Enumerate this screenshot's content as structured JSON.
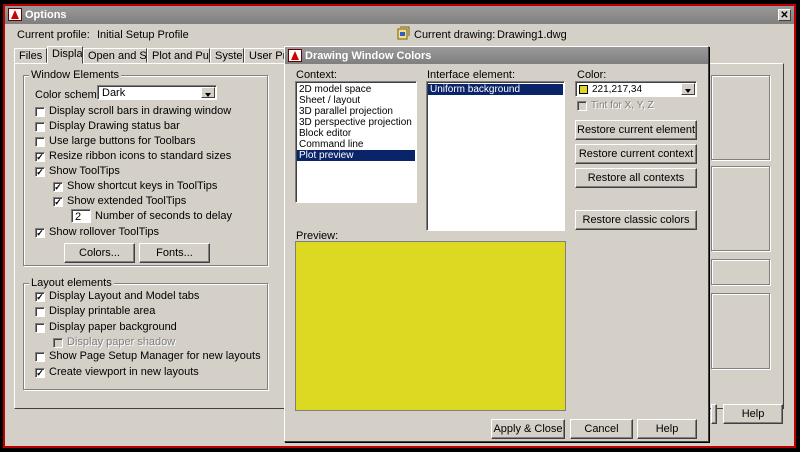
{
  "options_window": {
    "title": "Options",
    "current_profile_label": "Current profile:",
    "current_profile_value": "Initial Setup Profile",
    "current_drawing_label": "Current drawing:",
    "current_drawing_value": "Drawing1.dwg",
    "close_glyph": "✕",
    "tabs": [
      "Files",
      "Display",
      "Open and Save",
      "Plot and Publish",
      "System",
      "User Prefer"
    ],
    "active_tab": "Display",
    "window_elements": {
      "title": "Window Elements",
      "color_scheme_label": "Color scheme:",
      "color_scheme_value": "Dark",
      "items": [
        {
          "label": "Display scroll bars in drawing window",
          "checked": false
        },
        {
          "label": "Display Drawing status bar",
          "checked": false
        },
        {
          "label": "Use large buttons for Toolbars",
          "checked": false
        },
        {
          "label": "Resize ribbon icons to standard sizes",
          "checked": true
        },
        {
          "label": "Show ToolTips",
          "checked": true
        },
        {
          "label": "Show shortcut keys in ToolTips",
          "checked": true
        },
        {
          "label": "Show extended ToolTips",
          "checked": true
        },
        {
          "label": "Show rollover ToolTips",
          "checked": true
        }
      ],
      "seconds_value": "2",
      "seconds_label": "Number of seconds to delay",
      "colors_button": "Colors...",
      "fonts_button": "Fonts..."
    },
    "layout_elements": {
      "title": "Layout elements",
      "items": [
        {
          "label": "Display Layout and Model tabs",
          "checked": true
        },
        {
          "label": "Display printable area",
          "checked": false
        },
        {
          "label": "Display paper background",
          "checked": false
        },
        {
          "label": "Display paper shadow",
          "checked": false,
          "disabled": true
        },
        {
          "label": "Show Page Setup Manager for new layouts",
          "checked": false
        },
        {
          "label": "Create viewport in new layouts",
          "checked": true
        }
      ]
    },
    "help_button": "Help"
  },
  "dialog": {
    "title": "Drawing Window Colors",
    "context_label": "Context:",
    "contexts": [
      "2D model space",
      "Sheet / layout",
      "3D parallel projection",
      "3D perspective projection",
      "Block editor",
      "Command line",
      "Plot preview"
    ],
    "selected_context": "Plot preview",
    "interface_label": "Interface element:",
    "interface_elements": [
      "Uniform background"
    ],
    "color_label": "Color:",
    "color_value": "221,217,34",
    "color_hex": "#ddd922",
    "tint_label": "Tint for X, Y, Z",
    "buttons": {
      "restore_element": "Restore current element",
      "restore_context": "Restore current context",
      "restore_all": "Restore all contexts",
      "restore_classic": "Restore classic colors",
      "apply_close": "Apply & Close",
      "cancel": "Cancel",
      "help": "Help"
    },
    "preview_label": "Preview:",
    "check_glyph": "✓"
  }
}
